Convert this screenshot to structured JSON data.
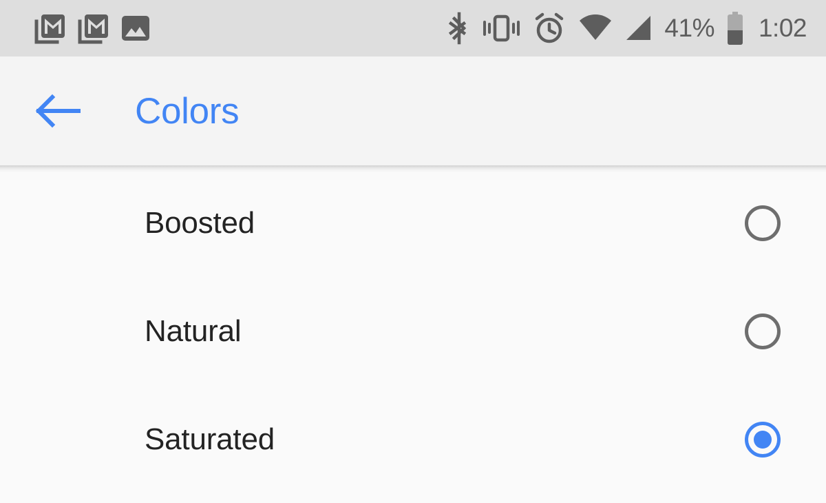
{
  "status_bar": {
    "background_color": "#dedede",
    "icon_color": "#5d5d5d",
    "notifications": [
      {
        "name": "gmail-notification-icon",
        "label": "Gmail"
      },
      {
        "name": "gmail-notification-icon-2",
        "label": "Gmail"
      },
      {
        "name": "screenshot-notification-icon",
        "label": "Screenshot"
      }
    ],
    "system_icons": [
      {
        "name": "bluetooth-icon",
        "label": "Bluetooth"
      },
      {
        "name": "vibrate-icon",
        "label": "Vibrate"
      },
      {
        "name": "alarm-icon",
        "label": "Alarm"
      },
      {
        "name": "wifi-icon",
        "label": "Wi-Fi"
      },
      {
        "name": "cellular-signal-icon",
        "label": "Cellular signal"
      }
    ],
    "battery_percent": "41%",
    "battery_level": 41,
    "clock": "1:02"
  },
  "app_bar": {
    "background_color": "#f4f4f4",
    "title": "Colors",
    "title_color": "#4285f4",
    "back_label": "Back"
  },
  "content": {
    "background_color": "#fafafa",
    "accent_color": "#4285f4",
    "unselected_color": "#6e6e6e",
    "options": [
      {
        "label": "Boosted",
        "selected": false
      },
      {
        "label": "Natural",
        "selected": false
      },
      {
        "label": "Saturated",
        "selected": true
      }
    ]
  }
}
